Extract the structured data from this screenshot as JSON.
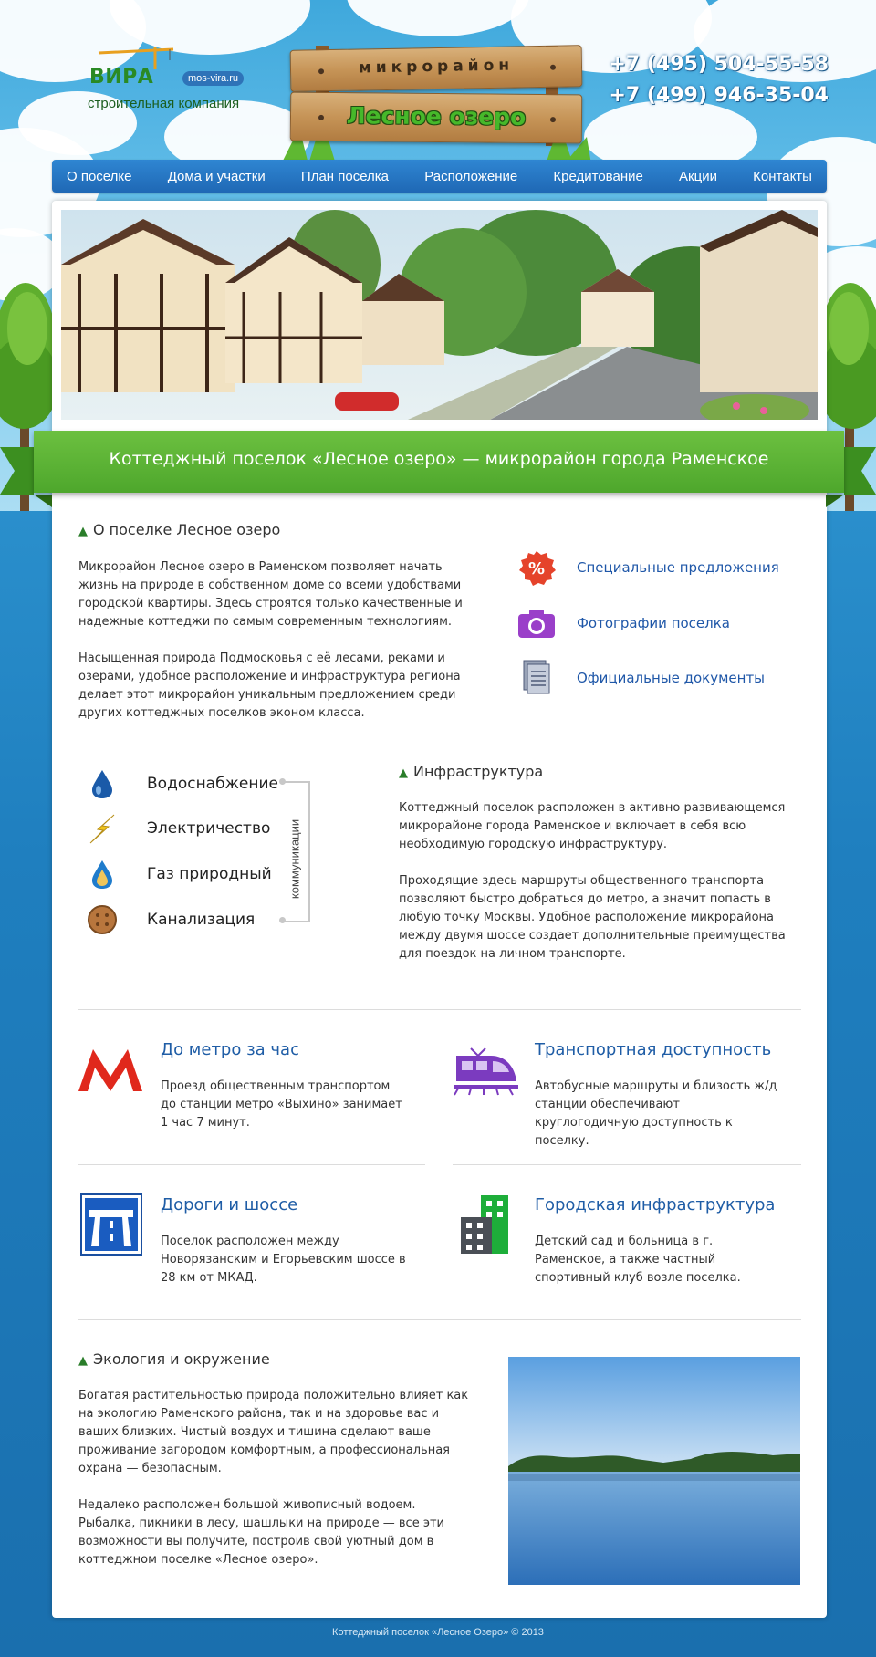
{
  "header": {
    "logo_word": "ВИРА",
    "logo_site": "mos-vira.ru",
    "logo_subtitle": "строительная компания",
    "sign_line1": "микрорайон",
    "sign_line2": "Лесное озеро",
    "phones": [
      "+7 (495) 504-55-58",
      "+7 (499) 946-35-04"
    ]
  },
  "nav": {
    "items": [
      "О поселке",
      "Дома и участки",
      "План поселка",
      "Расположение",
      "Кредитование",
      "Акции",
      "Контакты"
    ]
  },
  "banner": {
    "title": "Коттеджный поселок «Лесное озеро» — микрорайон города Раменское"
  },
  "about": {
    "heading": "О поселке Лесное озеро",
    "p1": "Микрорайон Лесное озеро в Раменском позволяет начать жизнь на природе в собственном доме со всеми удобствами городской квартиры. Здесь строятся только качественные и надежные коттеджи по самым современным технологиям.",
    "p2": "Насыщенная природа Подмосковья с её лесами, реками и озерами, удобное расположение и инфраструктура региона делает этот микрорайон уникальным предложением среди других коттеджных поселков эконом класса."
  },
  "quick_links": [
    {
      "label": "Специальные предложения",
      "icon": "percent-icon"
    },
    {
      "label": "Фотографии поселка",
      "icon": "camera-icon"
    },
    {
      "label": "Официальные документы",
      "icon": "documents-icon"
    }
  ],
  "utilities": {
    "items": [
      {
        "label": "Водоснабжение",
        "icon": "water-drop-icon"
      },
      {
        "label": "Электричество",
        "icon": "lightning-icon"
      },
      {
        "label": "Газ природный",
        "icon": "gas-drop-icon"
      },
      {
        "label": "Канализация",
        "icon": "sewer-hatch-icon"
      }
    ],
    "bracket_label": "коммуникации"
  },
  "infrastructure": {
    "heading": "Инфраструктура",
    "p1": "Коттеджный поселок расположен в активно развивающемся микрорайоне города Раменское и включает в себя всю необходимую городскую инфраструктуру.",
    "p2": "Проходящие здесь маршруты общественного транспорта позволяют быстро добраться до метро, а значит попасть в любую точку Москвы. Удобное расположение микрорайона между двумя шоссе создает дополнительные преимущества для поездок на личном транспорте."
  },
  "features": [
    {
      "title": "До метро за час",
      "text": "Проезд общественным транспортом до станции метро «Выхино» занимает 1 час 7 минут.",
      "icon": "metro-icon"
    },
    {
      "title": "Транспортная доступность",
      "text": "Автобусные маршруты и близость ж/д станции обеспечивают круглогодичную доступность к поселку.",
      "icon": "train-icon"
    },
    {
      "title": "Дороги и шоссе",
      "text": "Поселок расположен между Новорязанским и Егорьевским шоссе в 28 км от МКАД.",
      "icon": "highway-sign-icon"
    },
    {
      "title": "Городская инфраструктура",
      "text": "Детский сад и больница в г. Раменское, а также частный спортивный клуб возле поселка.",
      "icon": "buildings-icon"
    }
  ],
  "ecology": {
    "heading": "Экология и окружение",
    "p1": "Богатая растительностью природа положительно влияет как на экологию Раменского района, так и на здоровье вас и ваших близких. Чистый воздух и тишина сделают ваше проживание загородом комфортным, а профессиональная охрана — безопасным.",
    "p2": "Недалеко расположен большой живописный водоем. Рыбалка, пикники в лесу, шашлыки на природе — все эти возможности вы получите, построив свой уютный дом в коттеджном поселке «Лесное озеро»."
  },
  "footer": {
    "text": "Коттеджный поселок «Лесное Озеро» © 2013"
  },
  "colors": {
    "nav": "#1f68b5",
    "ribbon": "#4ea72c",
    "link": "#1f57a8",
    "feature_title": "#1f5da6",
    "page_bg": "#1e7fbd"
  }
}
